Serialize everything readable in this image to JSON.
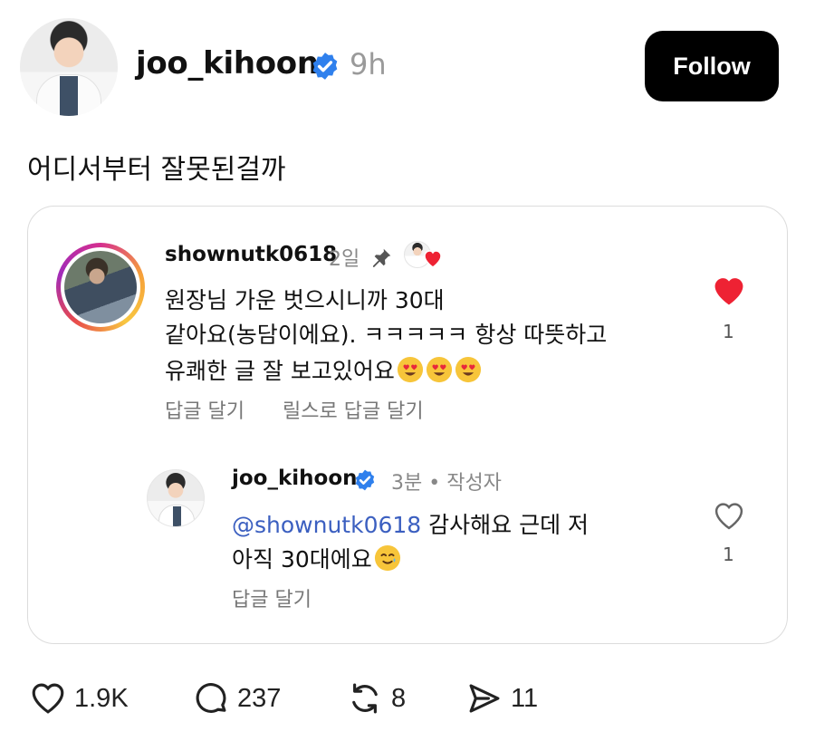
{
  "post": {
    "username": "joo_kihoon",
    "time": "9h",
    "follow_label": "Follow",
    "text": "어디서부터 잘못된걸까"
  },
  "quoted_comment": {
    "username": "shownutk0618",
    "time": "2일",
    "lines": [
      "원장님 가운 벗으시니까 30대",
      "같아요(농담이에요). ㅋㅋㅋㅋㅋ 항상 따뜻하고",
      "유쾌한 글 잘 보고있어요"
    ],
    "emoji": [
      "smiling-face-with-heart-eyes",
      "smiling-face-with-heart-eyes",
      "smiling-face-with-heart-eyes"
    ],
    "reply_label": "답글 달기",
    "reels_reply_label": "릴스로 답글 달기",
    "like_count": "1",
    "liked": true
  },
  "reply": {
    "username": "joo_kihoon",
    "time": "3분 • 작성자",
    "mention": "@shownutk0618",
    "line1_rest": " 감사해요 근데 저",
    "line2": "아직 30대에요",
    "emoji": "smiling-face-with-tear",
    "reply_label": "답글 달기",
    "like_count": "1",
    "liked": false
  },
  "footer": {
    "likes": "1.9K",
    "comments": "237",
    "reposts": "8",
    "shares": "11"
  },
  "colors": {
    "follow_bg": "#000000",
    "verified": "#2f80ed",
    "heart_liked": "#ee2233",
    "mention": "#3b5fc0"
  }
}
